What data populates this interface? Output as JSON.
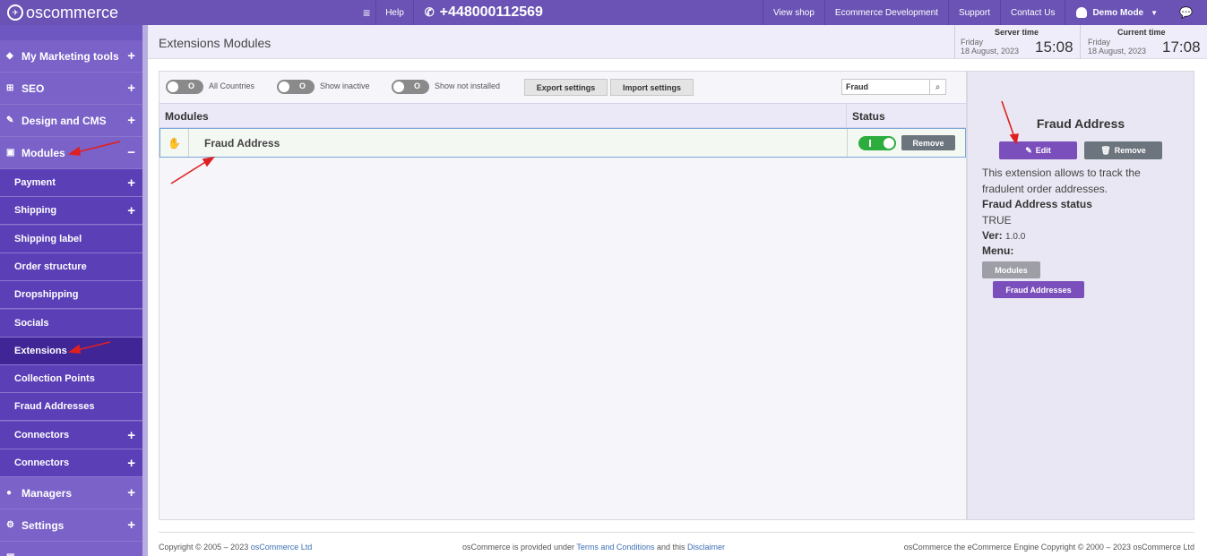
{
  "topbar": {
    "logo": "oscommerce",
    "help": "Help",
    "phone": "+448000112569",
    "view_shop": "View shop",
    "ecommerce_dev": "Ecommerce Development",
    "support": "Support",
    "contact": "Contact Us",
    "user": "Demo Mode"
  },
  "sidebar": {
    "main": [
      {
        "label": "My Marketing tools"
      },
      {
        "label": "SEO"
      },
      {
        "label": "Design and CMS"
      },
      {
        "label": "Modules"
      }
    ],
    "sub": [
      {
        "label": "Payment"
      },
      {
        "label": "Shipping"
      },
      {
        "label": "Shipping label"
      },
      {
        "label": "Order structure"
      },
      {
        "label": "Dropshipping"
      },
      {
        "label": "Socials"
      },
      {
        "label": "Extensions"
      },
      {
        "label": "Collection Points"
      },
      {
        "label": "Fraud Addresses"
      },
      {
        "label": "Connectors"
      },
      {
        "label": "Connectors"
      }
    ],
    "bottom": [
      {
        "label": "Managers"
      },
      {
        "label": "Settings"
      }
    ]
  },
  "header": {
    "title": "Extensions Modules",
    "server_label": "Server time",
    "server_day": "Friday",
    "server_date": "18 August, 2023",
    "server_time": "15:08",
    "current_label": "Current time",
    "current_day": "Friday",
    "current_date": "18 August, 2023",
    "current_time": "17:08"
  },
  "toolbar": {
    "toggle_off": "O",
    "all_countries": "All Countries",
    "show_inactive": "Show inactive",
    "show_not_installed": "Show not installed",
    "export": "Export settings",
    "import": "Import settings",
    "search_value": "Fraud"
  },
  "table": {
    "col_modules": "Modules",
    "col_status": "Status",
    "rows": [
      {
        "name": "Fraud Address",
        "status": "on",
        "action": "Remove"
      }
    ]
  },
  "panel": {
    "title": "Fraud Address",
    "edit": "Edit",
    "remove": "Remove",
    "desc1": "This extension allows to track the",
    "desc2": "fradulent order addresses.",
    "status_label": "Fraud Address status",
    "status_value": "TRUE",
    "ver_label": "Ver:",
    "ver_value": "1.0.0",
    "menu_label": "Menu:",
    "menu_modules": "Modules",
    "menu_fraud": "Fraud Addresses"
  },
  "footer": {
    "copy_left": "Copyright © 2005 – 2023 ",
    "copy_left_link": "osCommerce Ltd",
    "center_a": "osCommerce is provided under ",
    "center_link1": "Terms and Conditions",
    "center_b": " and this ",
    "center_link2": "Disclaimer",
    "right": "osCommerce the eCommerce Engine Copyright © 2000 – 2023 osCommerce Ltd"
  },
  "colors": {
    "brand": "#6a53b4",
    "sidebar_sub": "#5a3fb7",
    "active": "#3f2596",
    "edit_button": "#7b4fbb",
    "status_on": "#2dad3e"
  }
}
